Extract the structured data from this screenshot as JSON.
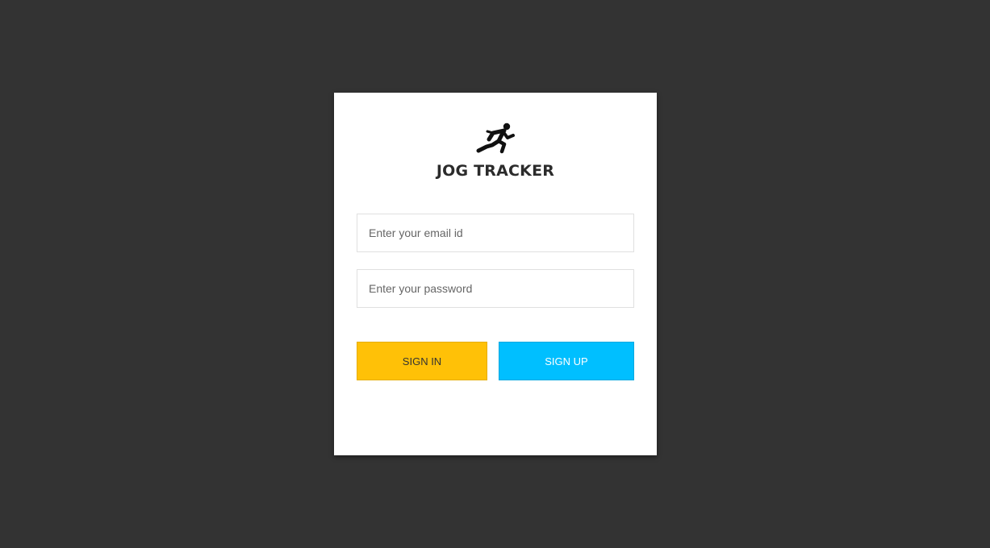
{
  "brand": {
    "title": "JOG TRACKER",
    "icon": "runner-icon"
  },
  "form": {
    "email_placeholder": "Enter your email id",
    "email_value": "",
    "password_placeholder": "Enter your password",
    "password_value": ""
  },
  "actions": {
    "signin_label": "SIGN IN",
    "signup_label": "SIGN UP"
  },
  "colors": {
    "background": "#333333",
    "card": "#ffffff",
    "signin": "#ffc107",
    "signup": "#00bfff"
  }
}
